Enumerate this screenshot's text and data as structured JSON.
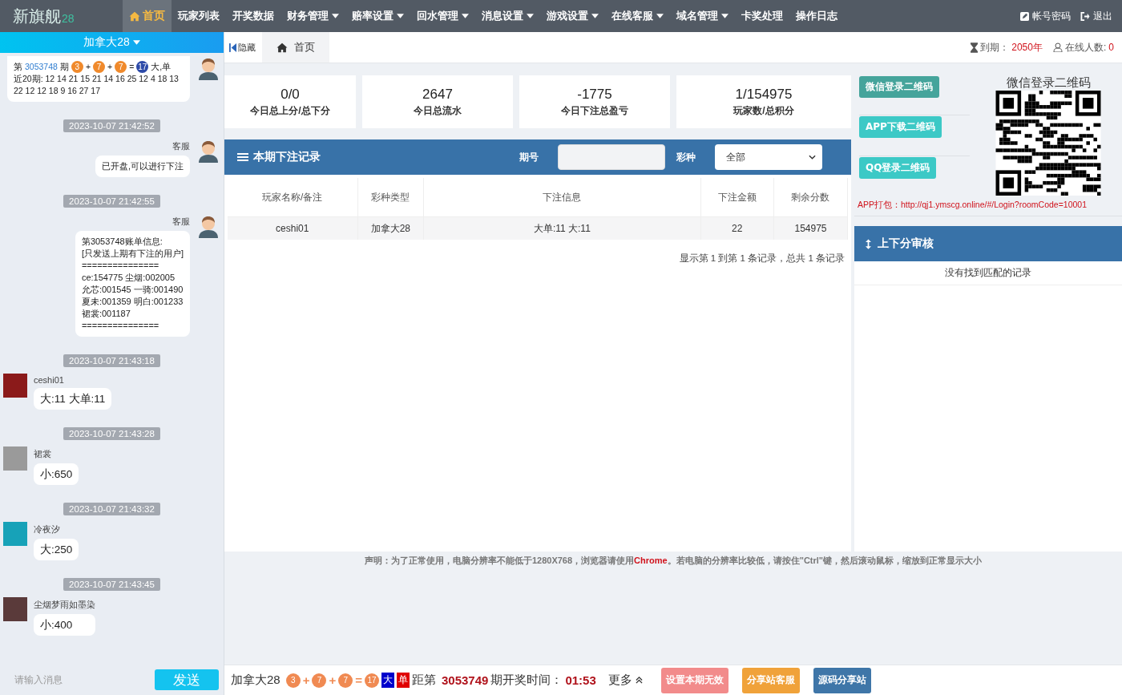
{
  "nav": {
    "logo": "新旗舰",
    "logo_suffix": "28",
    "items": [
      {
        "label": "首页",
        "selected": true,
        "dropdown": false
      },
      {
        "label": "玩家列表",
        "selected": false,
        "dropdown": false
      },
      {
        "label": "开奖数据",
        "selected": false,
        "dropdown": false
      },
      {
        "label": "财务管理",
        "selected": false,
        "dropdown": true
      },
      {
        "label": "赔率设置",
        "selected": false,
        "dropdown": true
      },
      {
        "label": "回水管理",
        "selected": false,
        "dropdown": true
      },
      {
        "label": "消息设置",
        "selected": false,
        "dropdown": true
      },
      {
        "label": "游戏设置",
        "selected": false,
        "dropdown": true
      },
      {
        "label": "在线客服",
        "selected": false,
        "dropdown": true
      },
      {
        "label": "域名管理",
        "selected": false,
        "dropdown": true
      },
      {
        "label": "卡奖处理",
        "selected": false,
        "dropdown": false
      },
      {
        "label": "操作日志",
        "selected": false,
        "dropdown": false
      }
    ],
    "account": "帐号密码",
    "logout": "退出"
  },
  "chat": {
    "room": "加拿大28",
    "messages": [
      {
        "kind": "draw",
        "outgoing": true,
        "prefix": "第",
        "period": "3053748",
        "period_suffix": "期",
        "expr": [
          {
            "kind": "num",
            "text": "3"
          },
          {
            "kind": "op",
            "text": "+"
          },
          {
            "kind": "num",
            "text": "7"
          },
          {
            "kind": "op",
            "text": "+"
          },
          {
            "kind": "num",
            "text": "7"
          },
          {
            "kind": "op",
            "text": "="
          },
          {
            "kind": "sum",
            "text": "17"
          }
        ],
        "result": "大,单",
        "recent": "近20期: 12 14 21 15 21 14 16 25 12 4 18 13 22 12 12 18 9 16 27 17"
      },
      {
        "kind": "time",
        "text": "2023-10-07 21:42:52"
      },
      {
        "kind": "text",
        "outgoing": true,
        "sender": "客服",
        "text": "已开盘,可以进行下注"
      },
      {
        "kind": "time",
        "text": "2023-10-07 21:42:55"
      },
      {
        "kind": "text",
        "outgoing": true,
        "sender": "客服",
        "text": "第3053748账单信息:\n[只发送上期有下注的用户]\n===============\nce:154775 尘烟:002005\n允芯:001545 一骑:001490\n夏未:001359 明白:001233\n裙裳:001187\n==============="
      },
      {
        "kind": "time",
        "text": "2023-10-07 21:43:18"
      },
      {
        "kind": "text",
        "outgoing": false,
        "sender": "ceshi01",
        "text": "大:11 大单:11",
        "color": "#8b1a1a"
      },
      {
        "kind": "time",
        "text": "2023-10-07 21:43:28"
      },
      {
        "kind": "text",
        "outgoing": false,
        "sender": "裙裳",
        "text": "小:650",
        "color": "#9a9a9a"
      },
      {
        "kind": "time",
        "text": "2023-10-07 21:43:32"
      },
      {
        "kind": "text",
        "outgoing": false,
        "sender": "冷夜汐",
        "text": "大:250",
        "color": "#17a2b8"
      },
      {
        "kind": "time",
        "text": "2023-10-07 21:43:45"
      },
      {
        "kind": "text",
        "outgoing": false,
        "sender": "尘烟梦雨如墨染",
        "text": "小:400",
        "color": "#5a3a3a"
      }
    ],
    "input": {
      "placeholder": "请输入消息"
    },
    "send": "发送"
  },
  "toolbar": {
    "hide": "隐藏",
    "tabs": [
      {
        "label": "首页",
        "selected": true
      }
    ],
    "expiry_label": "到期：",
    "expiry": "2050年",
    "online_label": "在线人数:",
    "online": "0"
  },
  "stats": [
    {
      "value": "0/0",
      "label": "今日总上分/总下分"
    },
    {
      "value": "2647",
      "label": "今日总流水"
    },
    {
      "value": "-1775",
      "label": "今日下注总盈亏"
    },
    {
      "value": "1/154975",
      "label": "玩家数/总积分"
    }
  ],
  "bets": {
    "title": "本期下注记录",
    "period_label": "期号",
    "lottery_label": "彩种",
    "lottery": "全部",
    "columns": [
      "玩家名称/备注",
      "彩种类型",
      "下注信息",
      "下注金额",
      "剩余分数"
    ],
    "rows": [
      [
        "ceshi01",
        "加拿大28",
        "大单:11 大:11",
        "22",
        "154975"
      ]
    ],
    "summary": "显示第 1 到第 1 条记录，总共 1 条记录"
  },
  "side": {
    "buttons": [
      {
        "label": "微信登录二维码",
        "color": "#45a49b"
      },
      {
        "label": "APP下载二维码",
        "color": "#3cc9c6"
      },
      {
        "label": "QQ登录二维码",
        "color": "#3cc9c6"
      }
    ],
    "qr_title": "微信登录二维码",
    "app_link": "APP打包：http://qj1.ymscg.online/#/Login?roomCode=10001",
    "audit_title": "上下分审核",
    "audit_empty": "没有找到匹配的记录"
  },
  "notice": "声明：为了正常使用，电脑分辨率不能低于1280X768，浏览器请使用**Chrome**。若电脑的分辨率比较低，请按住\"Ctrl\"键，然后滚动鼠标，缩放到正常显示大小",
  "bottom": {
    "game": "加拿大28",
    "expr": [
      {
        "kind": "num",
        "text": "3"
      },
      {
        "kind": "op",
        "text": "+"
      },
      {
        "kind": "num",
        "text": "7"
      },
      {
        "kind": "op",
        "text": "+"
      },
      {
        "kind": "num",
        "text": "7"
      },
      {
        "kind": "op",
        "text": "="
      },
      {
        "kind": "num",
        "text": "17"
      }
    ],
    "tags": [
      {
        "text": "大",
        "color": "#0000cc"
      },
      {
        "text": "单",
        "color": "#e00000"
      }
    ],
    "countdown_prefix": "距第",
    "period": "3053749",
    "countdown_label": "期开奖时间：",
    "time": "01:53",
    "more": "更多",
    "buttons": [
      {
        "label": "设置本期无效",
        "color": "#f28b8b"
      },
      {
        "label": "分享站客服",
        "color": "#f0a23a"
      },
      {
        "label": "源码分享站",
        "color": "#3f76a8"
      }
    ]
  }
}
